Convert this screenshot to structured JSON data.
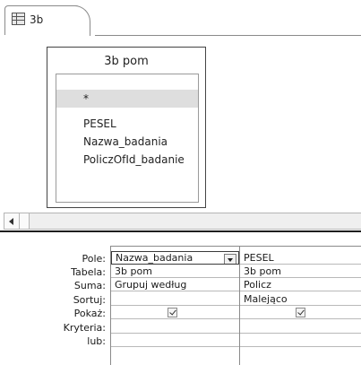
{
  "tab": {
    "label": "3b",
    "icon": "query-design-icon"
  },
  "table": {
    "title": "3b pom",
    "fields": [
      "*",
      "PESEL",
      "Nazwa_badania",
      "PoliczOfId_badanie"
    ]
  },
  "grid": {
    "row_labels": [
      "Pole:",
      "Tabela:",
      "Suma:",
      "Sortuj:",
      "Pokaż:",
      "Kryteria:",
      "lub:"
    ],
    "columns": [
      {
        "pole": "Nazwa_badania",
        "tabela": "3b pom",
        "suma": "Grupuj według",
        "sortuj": "",
        "pokaz": true,
        "kryteria": "",
        "lub": ""
      },
      {
        "pole": "PESEL",
        "tabela": "3b pom",
        "suma": "Policz",
        "sortuj": "Malejąco",
        "pokaz": true,
        "kryteria": "",
        "lub": ""
      }
    ]
  }
}
